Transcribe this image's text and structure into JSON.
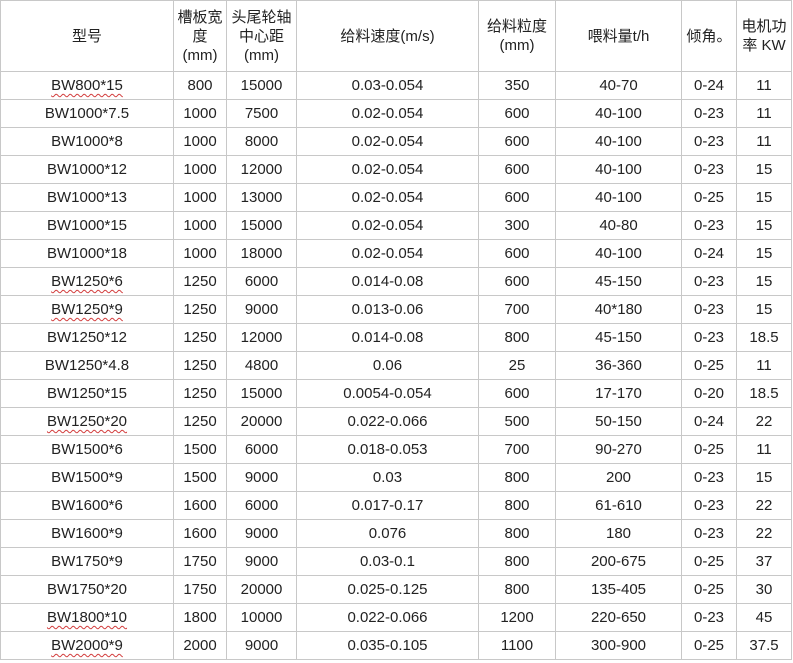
{
  "table": {
    "headers": [
      "型号",
      "槽板宽度(mm)",
      "头尾轮轴中心距(mm)",
      "给料速度(m/s)",
      "给料粒度(mm)",
      "喂料量t/h",
      "倾角。",
      "电机功率 KW"
    ],
    "rows": [
      [
        "BW800*15",
        "800",
        "15000",
        "0.03-0.054",
        "350",
        "40-70",
        "0-24",
        "11"
      ],
      [
        "BW1000*7.5",
        "1000",
        "7500",
        "0.02-0.054",
        "600",
        "40-100",
        "0-23",
        "11"
      ],
      [
        "BW1000*8",
        "1000",
        "8000",
        "0.02-0.054",
        "600",
        "40-100",
        "0-23",
        "11"
      ],
      [
        "BW1000*12",
        "1000",
        "12000",
        "0.02-0.054",
        "600",
        "40-100",
        "0-23",
        "15"
      ],
      [
        "BW1000*13",
        "1000",
        "13000",
        "0.02-0.054",
        "600",
        "40-100",
        "0-25",
        "15"
      ],
      [
        "BW1000*15",
        "1000",
        "15000",
        "0.02-0.054",
        "300",
        "40-80",
        "0-23",
        "15"
      ],
      [
        "BW1000*18",
        "1000",
        "18000",
        "0.02-0.054",
        "600",
        "40-100",
        "0-24",
        "15"
      ],
      [
        "BW1250*6",
        "1250",
        "6000",
        "0.014-0.08",
        "600",
        "45-150",
        "0-23",
        "15"
      ],
      [
        "BW1250*9",
        "1250",
        "9000",
        "0.013-0.06",
        "700",
        "40*180",
        "0-23",
        "15"
      ],
      [
        "BW1250*12",
        "1250",
        "12000",
        "0.014-0.08",
        "800",
        "45-150",
        "0-23",
        "18.5"
      ],
      [
        "BW1250*4.8",
        "1250",
        "4800",
        "0.06",
        "25",
        "36-360",
        "0-25",
        "11"
      ],
      [
        "BW1250*15",
        "1250",
        "15000",
        "0.0054-0.054",
        "600",
        "17-170",
        "0-20",
        "18.5"
      ],
      [
        "BW1250*20",
        "1250",
        "20000",
        "0.022-0.066",
        "500",
        "50-150",
        "0-24",
        "22"
      ],
      [
        "BW1500*6",
        "1500",
        "6000",
        "0.018-0.053",
        "700",
        "90-270",
        "0-25",
        "11"
      ],
      [
        "BW1500*9",
        "1500",
        "9000",
        "0.03",
        "800",
        "200",
        "0-23",
        "15"
      ],
      [
        "BW1600*6",
        "1600",
        "6000",
        "0.017-0.17",
        "800",
        "61-610",
        "0-23",
        "22"
      ],
      [
        "BW1600*9",
        "1600",
        "9000",
        "0.076",
        "800",
        "180",
        "0-23",
        "22"
      ],
      [
        "BW1750*9",
        "1750",
        "9000",
        "0.03-0.1",
        "800",
        "200-675",
        "0-25",
        "37"
      ],
      [
        "BW1750*20",
        "1750",
        "20000",
        "0.025-0.125",
        "800",
        "135-405",
        "0-25",
        "30"
      ],
      [
        "BW1800*10",
        "1800",
        "10000",
        "0.022-0.066",
        "1200",
        "220-650",
        "0-23",
        "45"
      ],
      [
        "BW2000*9",
        "2000",
        "9000",
        "0.035-0.105",
        "1100",
        "300-900",
        "0-25",
        "37.5"
      ]
    ]
  }
}
